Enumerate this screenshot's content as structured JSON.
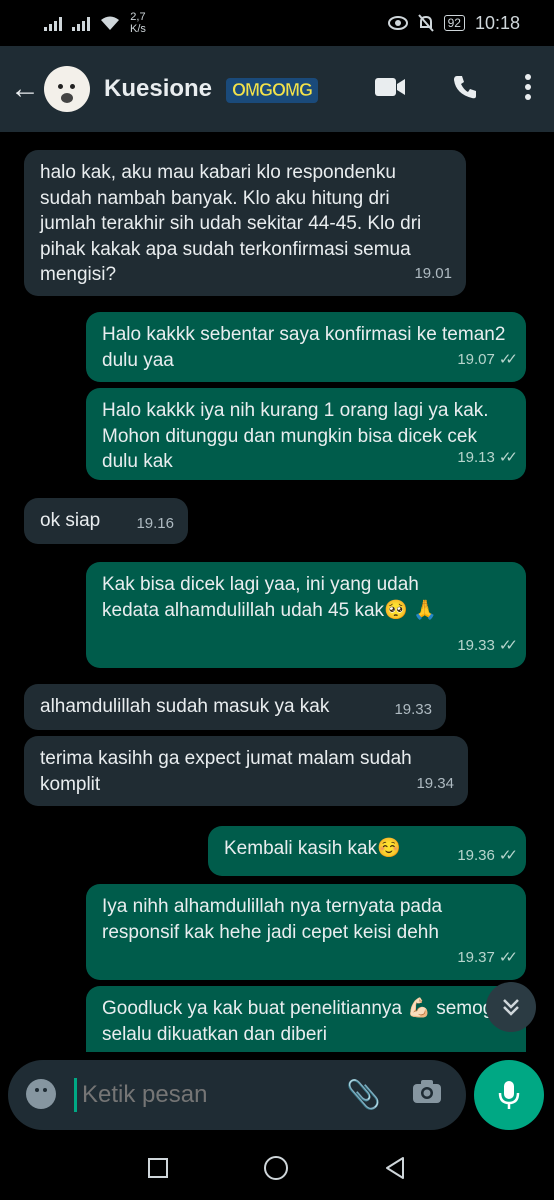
{
  "status_bar": {
    "speed_value": "2,7",
    "speed_unit": "K/s",
    "battery": "92",
    "time": "10:18"
  },
  "header": {
    "contact_name": "Kuesione",
    "sticker_text": "OMGOMG"
  },
  "icons": {
    "back": "arrow-left",
    "video": "video-camera",
    "call": "phone",
    "menu": "vertical-dots",
    "scroll": "double-chevron-down",
    "emoji": "smiley",
    "attach": "paperclip",
    "camera": "camera",
    "mic": "microphone"
  },
  "messages": [
    {
      "dir": "in",
      "text": "halo kak, aku mau kabari klo respondenku sudah nambah banyak. Klo aku hitung dri jumlah terakhir sih udah sekitar 44-45. Klo dri pihak kakak apa sudah terkonfirmasi semua mengisi?",
      "time": "19.01"
    },
    {
      "dir": "out",
      "text": "Halo kakkk sebentar saya konfirmasi ke teman2 dulu yaa",
      "time": "19.07"
    },
    {
      "dir": "out",
      "text": "Halo kakkk iya nih kurang 1 orang lagi ya kak. Mohon ditunggu dan mungkin bisa dicek cek dulu kak",
      "time": "19.13"
    },
    {
      "dir": "in",
      "text": "ok siap",
      "time": "19.16"
    },
    {
      "dir": "out",
      "text": "Kak bisa dicek lagi yaa, ini yang udah kedata alhamdulillah udah 45 kak🥺 🙏",
      "time": "19.33"
    },
    {
      "dir": "in",
      "text": "alhamdulillah sudah masuk ya kak",
      "time": "19.33"
    },
    {
      "dir": "in",
      "text": "terima kasihh ga expect jumat malam sudah komplit",
      "time": "19.34"
    },
    {
      "dir": "out",
      "text": "Kembali kasih kak☺️",
      "time": "19.36"
    },
    {
      "dir": "out",
      "text": "Iya nihh alhamdulillah nya ternyata pada responsif kak hehe jadi cepet keisi dehh",
      "time": "19.37"
    },
    {
      "dir": "out",
      "text": "Goodluck ya kak buat penelitiannya 💪🏻 semoga selalu dikuatkan dan diberi",
      "time": ""
    }
  ],
  "input": {
    "placeholder": "Ketik pesan"
  },
  "colors": {
    "header_bg": "#1f2c34",
    "incoming_bubble": "#202c33",
    "outgoing_bubble": "#005c4b",
    "accent": "#00a884"
  }
}
